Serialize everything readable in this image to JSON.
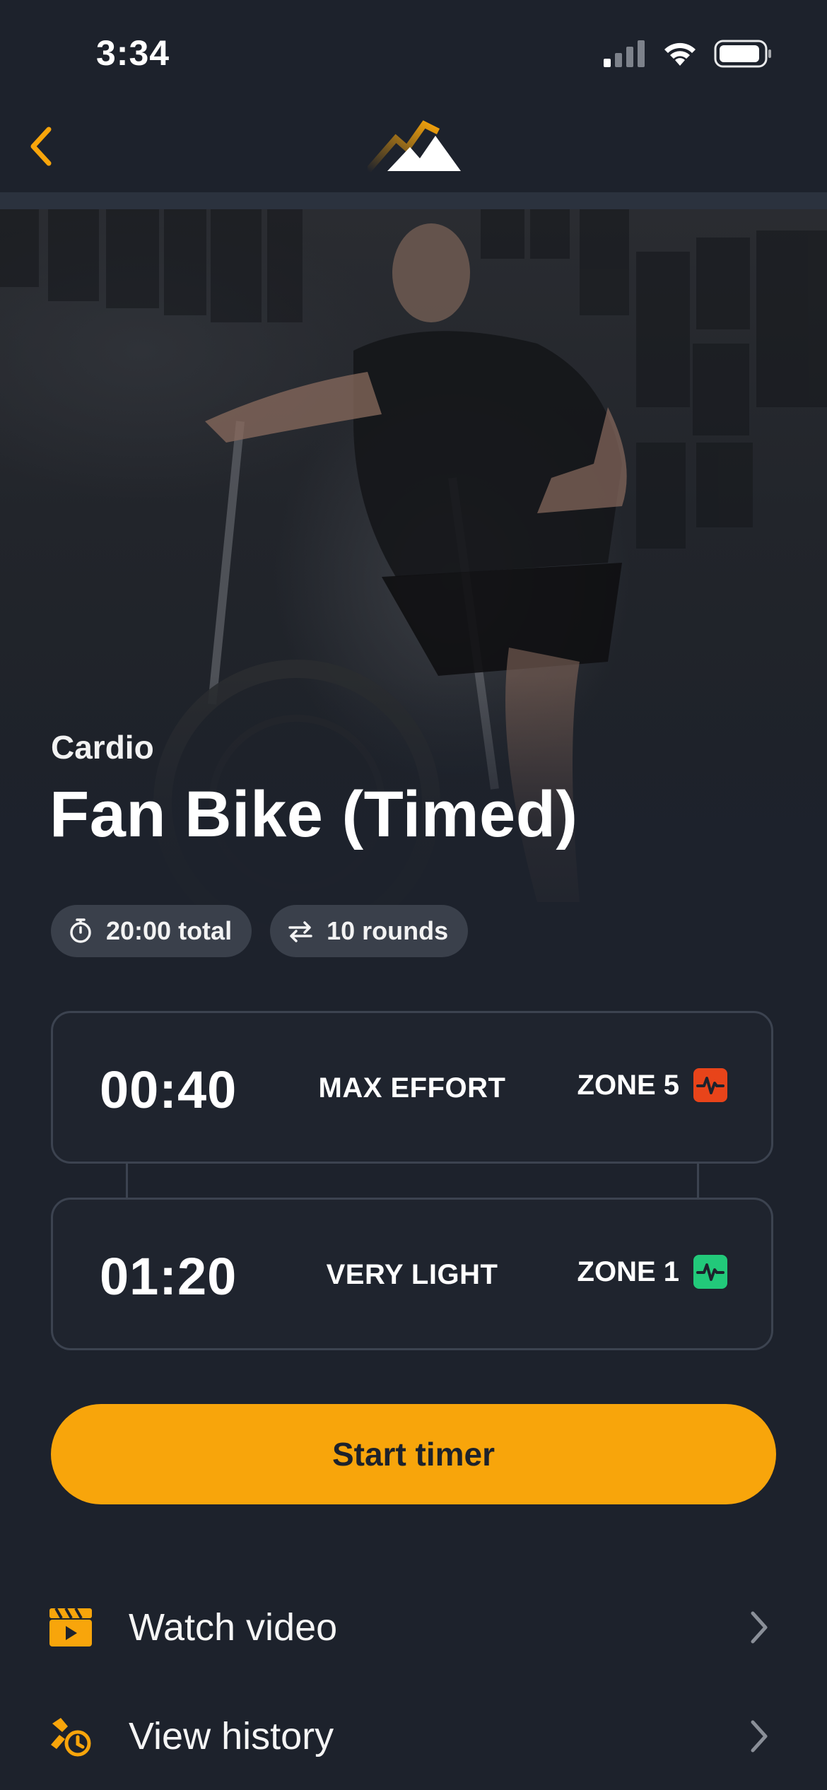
{
  "status_bar": {
    "time": "3:34"
  },
  "nav": {
    "logo": "mountain-logo"
  },
  "exercise": {
    "category": "Cardio",
    "title": "Fan Bike (Timed)",
    "chips": [
      {
        "icon": "stopwatch-icon",
        "label": "20:00 total"
      },
      {
        "icon": "repeat-icon",
        "label": "10 rounds"
      }
    ]
  },
  "intervals": [
    {
      "time": "00:40",
      "effort": "MAX EFFORT",
      "zone": "ZONE 5",
      "zone_color": "#e8441a"
    },
    {
      "time": "01:20",
      "effort": "VERY LIGHT",
      "zone": "ZONE 1",
      "zone_color": "#22c97a"
    }
  ],
  "actions": {
    "start_label": "Start timer",
    "accent_color": "#f8a50b",
    "watch_video_label": "Watch video",
    "view_history_label": "View history"
  }
}
